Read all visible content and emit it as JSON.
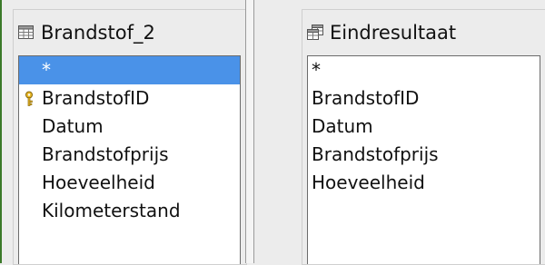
{
  "left_table": {
    "title": "Brandstof_2",
    "icon": "table-icon",
    "fields": [
      {
        "label": "*",
        "selected": true,
        "primary_key": false
      },
      {
        "label": "BrandstofID",
        "selected": false,
        "primary_key": true
      },
      {
        "label": "Datum",
        "selected": false,
        "primary_key": false
      },
      {
        "label": "Brandstofprijs",
        "selected": false,
        "primary_key": false
      },
      {
        "label": "Hoeveelheid",
        "selected": false,
        "primary_key": false
      },
      {
        "label": "Kilometerstand",
        "selected": false,
        "primary_key": false
      }
    ]
  },
  "right_table": {
    "title": "Eindresultaat",
    "icon": "query-icon",
    "fields": [
      {
        "label": "*"
      },
      {
        "label": "BrandstofID"
      },
      {
        "label": "Datum"
      },
      {
        "label": "Brandstofprijs"
      },
      {
        "label": "Hoeveelheid"
      }
    ]
  },
  "colors": {
    "selection": "#4a92e8",
    "left_accent_border": "#3b7a2a",
    "key_icon": "#d4a017"
  }
}
